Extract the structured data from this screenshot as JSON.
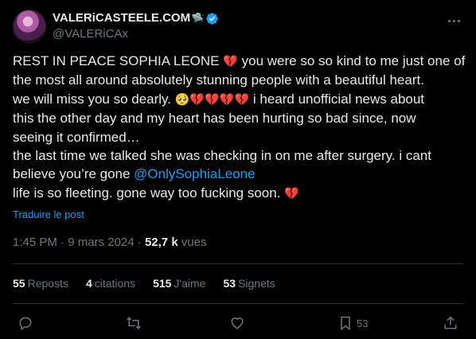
{
  "author": {
    "display_name": "VALERiCASTEELE.COM",
    "name_emoji": "🛸",
    "handle": "@VALERiCAx"
  },
  "tweet": {
    "line1": "REST IN PEACE SOPHIA LEONE",
    "line1_after": " you were so so kind to me just one of",
    "line2": "the most all around absolutely stunning people with a beautiful heart.",
    "line3a": "we will miss you so dearly. ",
    "line3_emojis": "🥺💔💔💔💔",
    "line3b": " i heard unofficial news about",
    "line4": "this the other day and my heart has been hurting so bad since, now",
    "line5": "seeing it confirmed…",
    "line6": "the last time we talked she was checking in on me after surgery. i cant",
    "line7a": "believe you’re gone ",
    "mention": "@OnlySophiaLeone",
    "line8": "life is so fleeting. gone way too fucking soon. ",
    "heart": "💔"
  },
  "translate_label": "Traduire le post",
  "meta": {
    "time": "1:45 PM",
    "sep": " · ",
    "date": "9 mars 2024",
    "views_num": "52,7 k",
    "views_label": " vues"
  },
  "stats": {
    "reposts_num": "55",
    "reposts_label": "Reposts",
    "quotes_num": "4",
    "quotes_label": "citations",
    "likes_num": "515",
    "likes_label": "J'aime",
    "bookmarks_num": "53",
    "bookmarks_label": "Signets"
  },
  "actions": {
    "bookmark_count": "53"
  },
  "colors": {
    "background": "#000000",
    "text": "#e7e9ea",
    "secondary": "#71767b",
    "accent": "#1d9bf0",
    "divider": "#2f3336"
  }
}
